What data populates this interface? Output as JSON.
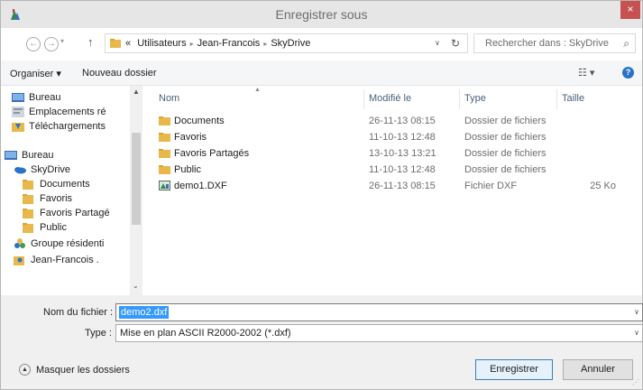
{
  "window": {
    "title": "Enregistrer sous",
    "close_glyph": "×"
  },
  "nav": {
    "back_glyph": "←",
    "forward_glyph": "→",
    "dropdown_glyph": "▾",
    "up_glyph": "↑",
    "breadcrumb_prefix": "«",
    "breadcrumbs": [
      "Utilisateurs",
      "Jean-Francois",
      "SkyDrive"
    ],
    "crumb_sep": "▸",
    "address_chevron": "∨",
    "refresh_glyph": "↻",
    "search_placeholder": "Rechercher dans : SkyDrive",
    "search_icon_glyph": "⌕"
  },
  "toolbar": {
    "organize_label": "Organiser ▾",
    "new_folder_label": "Nouveau dossier",
    "view_glyph": "☷ ▾",
    "help_glyph": "?"
  },
  "sidebar": {
    "items": [
      {
        "label": "Bureau",
        "icon": "desktop-icon"
      },
      {
        "label": "Emplacements ré",
        "icon": "recent-places-icon"
      },
      {
        "label": "Téléchargements",
        "icon": "downloads-icon"
      },
      {
        "label": "Bureau",
        "icon": "desktop-icon"
      },
      {
        "label": "SkyDrive",
        "icon": "skydrive-icon"
      },
      {
        "label": "Documents",
        "icon": "folder-icon"
      },
      {
        "label": "Favoris",
        "icon": "folder-icon"
      },
      {
        "label": "Favoris Partagé",
        "icon": "folder-icon"
      },
      {
        "label": "Public",
        "icon": "folder-icon"
      },
      {
        "label": "Groupe résidenti",
        "icon": "homegroup-icon"
      },
      {
        "label": "Jean-Francois .",
        "icon": "user-folder-icon"
      }
    ],
    "scroll_up_glyph": "▲",
    "scroll_down_glyph": "⌄"
  },
  "filelist": {
    "columns": [
      "Nom",
      "Modifié le",
      "Type",
      "Taille"
    ],
    "sort_glyph": "▲",
    "rows": [
      {
        "name": "Documents",
        "modified": "26-11-13 08:15",
        "type": "Dossier de fichiers",
        "size": "",
        "icon": "folder-icon"
      },
      {
        "name": "Favoris",
        "modified": "11-10-13 12:48",
        "type": "Dossier de fichiers",
        "size": "",
        "icon": "folder-icon"
      },
      {
        "name": "Favoris Partagés",
        "modified": "13-10-13 13:21",
        "type": "Dossier de fichiers",
        "size": "",
        "icon": "folder-icon"
      },
      {
        "name": "Public",
        "modified": "11-10-13 12:48",
        "type": "Dossier de fichiers",
        "size": "",
        "icon": "folder-icon"
      },
      {
        "name": "demo1.DXF",
        "modified": "26-11-13 08:15",
        "type": "Fichier DXF",
        "size": "25 Ko",
        "icon": "dxf-file-icon"
      }
    ]
  },
  "form": {
    "filename_label": "Nom du fichier :",
    "filename_value": "demo2.dxf",
    "type_label": "Type :",
    "type_value": "Mise en plan ASCII R2000-2002 (*.dxf)",
    "chevron": "∨"
  },
  "footer": {
    "hide_folders_label": "Masquer les dossiers",
    "hide_glyph": "▲",
    "save_label": "Enregistrer",
    "cancel_label": "Annuler",
    "grip_glyph": "⋰"
  },
  "colors": {
    "folder": "#e8b84a",
    "accent": "#3399ff",
    "close": "#c75050",
    "skydrive": "#2a73c8"
  }
}
